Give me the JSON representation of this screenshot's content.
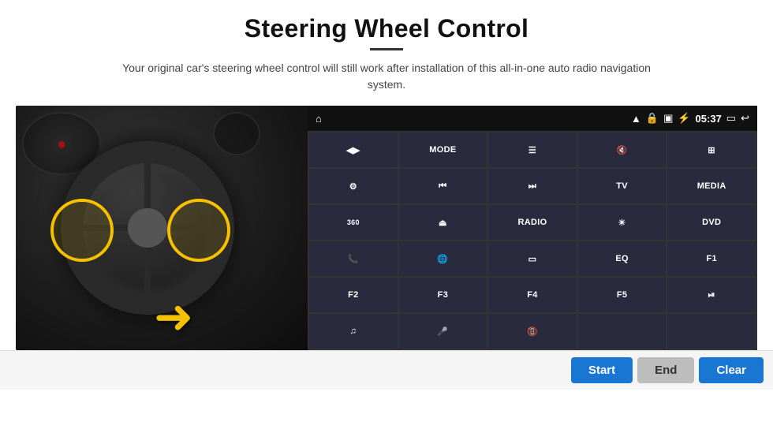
{
  "header": {
    "title": "Steering Wheel Control",
    "subtitle": "Your original car's steering wheel control will still work after installation of this all-in-one auto radio navigation system."
  },
  "status_bar": {
    "time": "05:37",
    "home_icon": "⌂",
    "wifi_icon": "wifi",
    "lock_icon": "🔒",
    "sd_icon": "SD",
    "bt_icon": "⚡",
    "screen_icon": "▭",
    "back_icon": "↩"
  },
  "grid_buttons": [
    {
      "row": 1,
      "col": 1,
      "type": "icon",
      "label": "navigate",
      "text": "◀▶"
    },
    {
      "row": 1,
      "col": 2,
      "type": "text",
      "label": "MODE",
      "text": "MODE"
    },
    {
      "row": 1,
      "col": 3,
      "type": "icon",
      "label": "list",
      "text": "☰"
    },
    {
      "row": 1,
      "col": 4,
      "type": "icon",
      "label": "mute",
      "text": "🔇"
    },
    {
      "row": 1,
      "col": 5,
      "type": "icon",
      "label": "apps",
      "text": "⊞"
    },
    {
      "row": 2,
      "col": 1,
      "type": "icon",
      "label": "settings-gear",
      "text": "⚙"
    },
    {
      "row": 2,
      "col": 2,
      "type": "icon",
      "label": "prev-track",
      "text": "⏮"
    },
    {
      "row": 2,
      "col": 3,
      "type": "icon",
      "label": "next-track",
      "text": "⏭"
    },
    {
      "row": 2,
      "col": 4,
      "type": "text",
      "label": "TV",
      "text": "TV"
    },
    {
      "row": 2,
      "col": 5,
      "type": "text",
      "label": "MEDIA",
      "text": "MEDIA"
    },
    {
      "row": 3,
      "col": 1,
      "type": "icon",
      "label": "360-cam",
      "text": "360"
    },
    {
      "row": 3,
      "col": 2,
      "type": "icon",
      "label": "eject",
      "text": "⏏"
    },
    {
      "row": 3,
      "col": 3,
      "type": "text",
      "label": "RADIO",
      "text": "RADIO"
    },
    {
      "row": 3,
      "col": 4,
      "type": "icon",
      "label": "brightness",
      "text": "☀"
    },
    {
      "row": 3,
      "col": 5,
      "type": "text",
      "label": "DVD",
      "text": "DVD"
    },
    {
      "row": 4,
      "col": 1,
      "type": "icon",
      "label": "phone",
      "text": "📞"
    },
    {
      "row": 4,
      "col": 2,
      "type": "icon",
      "label": "globe",
      "text": "🌐"
    },
    {
      "row": 4,
      "col": 3,
      "type": "icon",
      "label": "window",
      "text": "▭"
    },
    {
      "row": 4,
      "col": 4,
      "type": "text",
      "label": "EQ",
      "text": "EQ"
    },
    {
      "row": 4,
      "col": 5,
      "type": "text",
      "label": "F1",
      "text": "F1"
    },
    {
      "row": 5,
      "col": 1,
      "type": "text",
      "label": "F2",
      "text": "F2"
    },
    {
      "row": 5,
      "col": 2,
      "type": "text",
      "label": "F3",
      "text": "F3"
    },
    {
      "row": 5,
      "col": 3,
      "type": "text",
      "label": "F4",
      "text": "F4"
    },
    {
      "row": 5,
      "col": 4,
      "type": "text",
      "label": "F5",
      "text": "F5"
    },
    {
      "row": 5,
      "col": 5,
      "type": "icon",
      "label": "play-pause",
      "text": "⏯"
    },
    {
      "row": 6,
      "col": 1,
      "type": "icon",
      "label": "music",
      "text": "♫"
    },
    {
      "row": 6,
      "col": 2,
      "type": "icon",
      "label": "mic",
      "text": "🎤"
    },
    {
      "row": 6,
      "col": 3,
      "type": "icon",
      "label": "call-end",
      "text": "📵"
    },
    {
      "row": 6,
      "col": 4,
      "type": "empty",
      "label": "",
      "text": ""
    },
    {
      "row": 6,
      "col": 5,
      "type": "empty",
      "label": "",
      "text": ""
    }
  ],
  "action_bar": {
    "start_label": "Start",
    "end_label": "End",
    "clear_label": "Clear"
  }
}
